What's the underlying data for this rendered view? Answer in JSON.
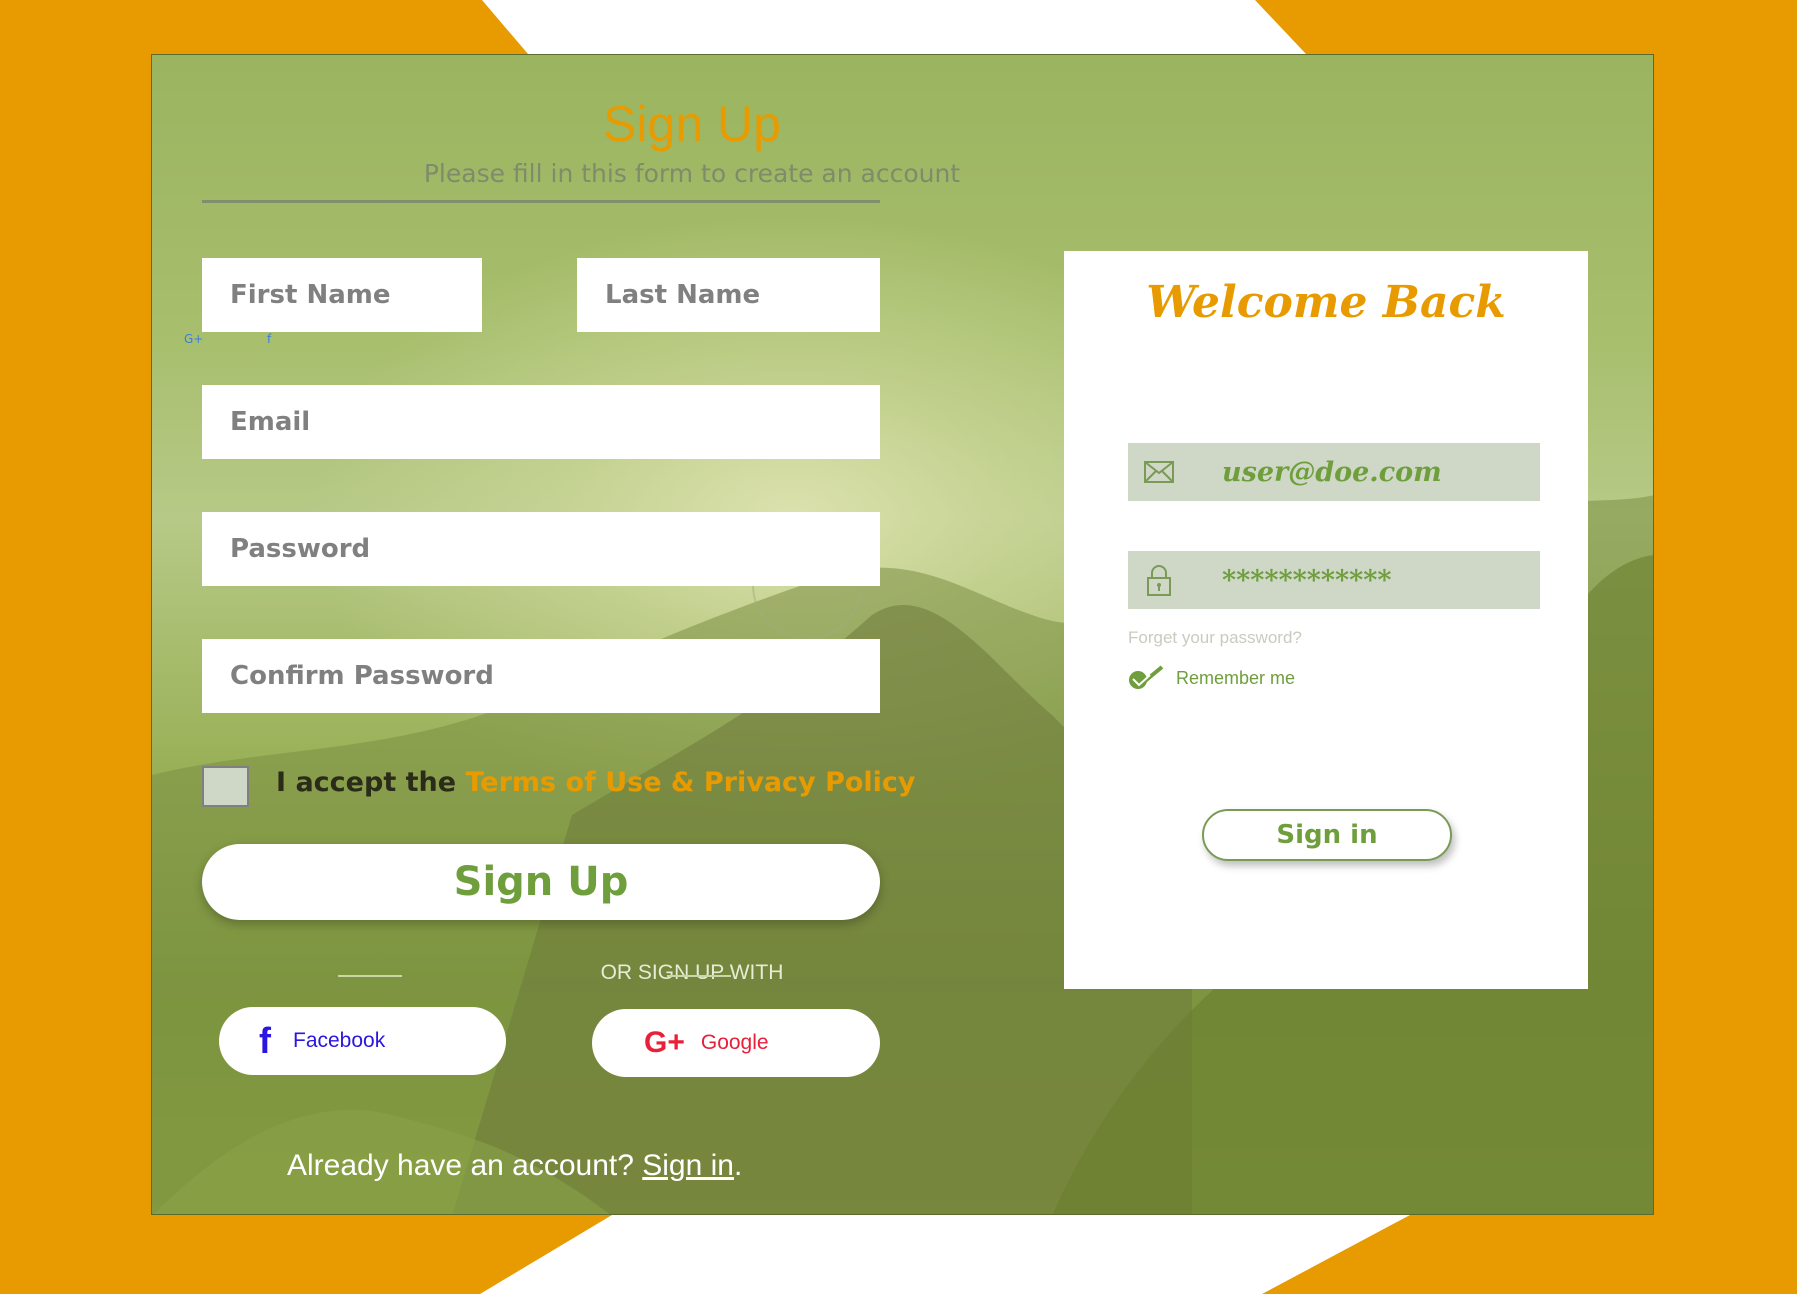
{
  "signup": {
    "title": "Sign Up",
    "subtitle": "Please fill in this form to create an account",
    "first_name_placeholder": "First Name",
    "last_name_placeholder": "Last Name",
    "email_placeholder": "Email",
    "password_placeholder": "Password",
    "confirm_password_placeholder": "Confirm Password",
    "accept_prefix": "I accept the ",
    "terms_link": "Terms of Use & Privacy Policy",
    "button_label": "Sign Up",
    "or_text": "OR SIGN UP WITH",
    "facebook_label": "Facebook",
    "google_label": "Google",
    "already_text": "Already have an account? ",
    "already_link": "Sign in",
    "already_suffix": "."
  },
  "signin": {
    "title": "Welcome Back",
    "email_value": "user@doe.com",
    "password_value": "************",
    "forgot_link": "Forget your password?",
    "remember_label": "Remember me",
    "remember_checked": true,
    "button_label": "Sign in"
  },
  "icons": {
    "facebook": "f",
    "google": "G+",
    "email": "envelope-icon",
    "password": "lock-icon",
    "remember": "checkmark-icon"
  },
  "colors": {
    "accent": "#e89b00",
    "green": "#6f9e3d",
    "facebook": "#2a16e0",
    "google": "#e8203a"
  }
}
